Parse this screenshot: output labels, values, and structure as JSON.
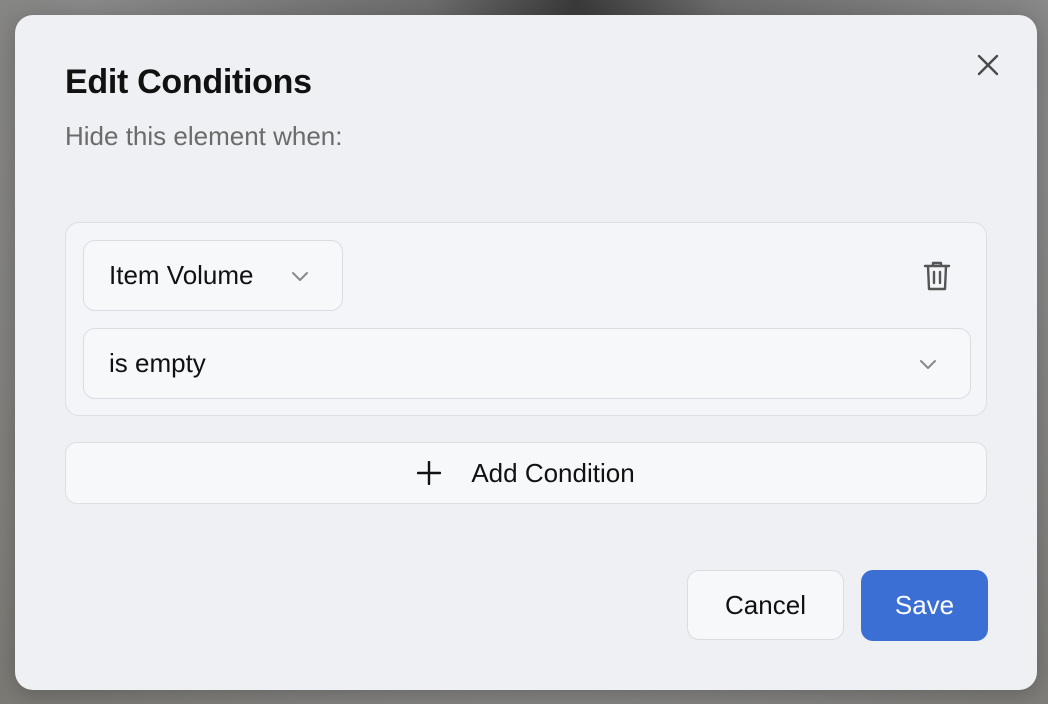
{
  "dialog": {
    "title": "Edit Conditions",
    "subtitle": "Hide this element when:",
    "close_icon": "close-icon"
  },
  "condition": {
    "field_value": "Item Volume",
    "operator_value": "is empty",
    "delete_icon": "trash-icon",
    "chevron_icon": "chevron-down-icon"
  },
  "actions": {
    "add_condition_label": "Add Condition",
    "add_icon": "plus-icon",
    "cancel_label": "Cancel",
    "save_label": "Save"
  },
  "colors": {
    "accent": "#3b6fd4",
    "dialog_bg": "#eef0f3",
    "text_primary": "#111111",
    "text_secondary": "#6b6b6b"
  }
}
